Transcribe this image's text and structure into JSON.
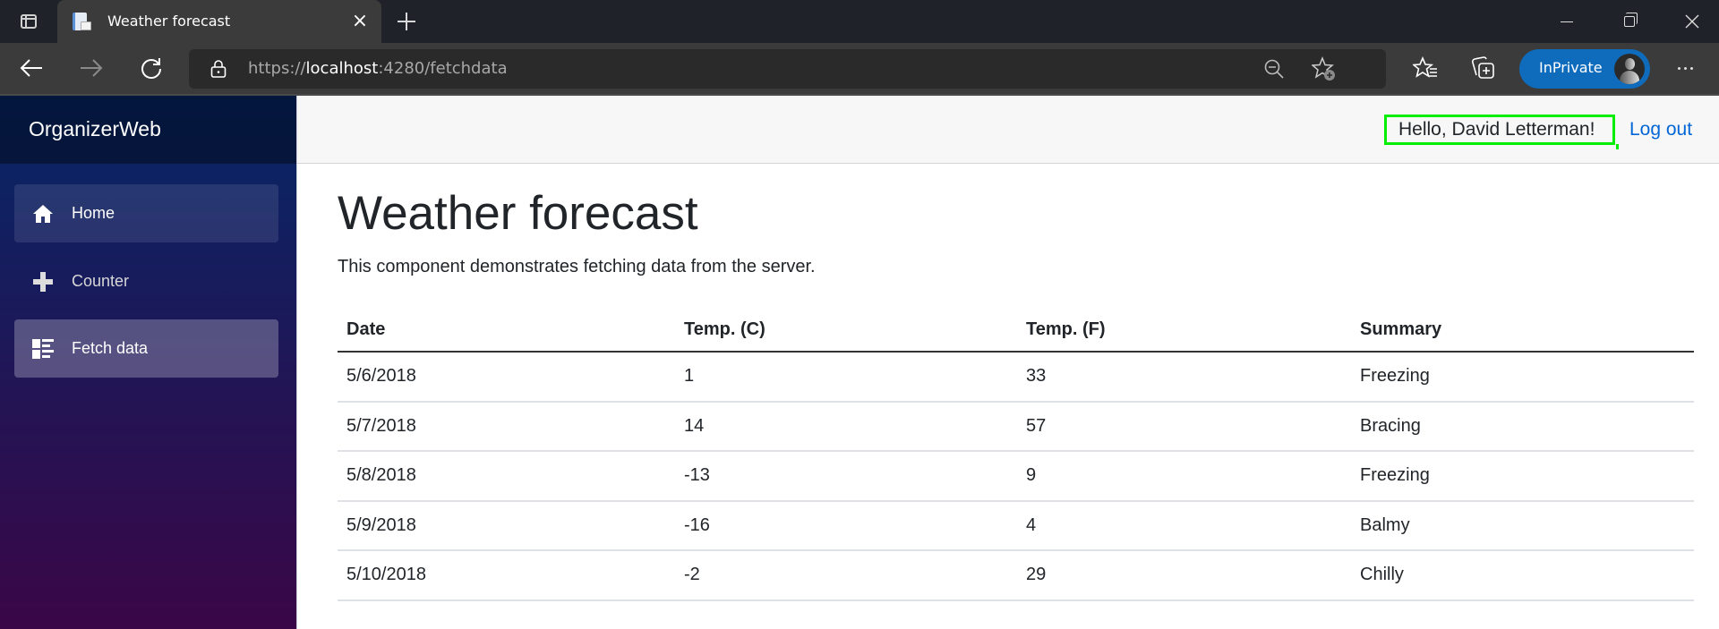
{
  "browser": {
    "tab": {
      "title": "Weather forecast",
      "favicon": "document-favicon-icon"
    },
    "url": {
      "scheme": "https://",
      "host": "localhost",
      "rest": ":4280/fetchdata"
    },
    "inprivate_label": "InPrivate",
    "icons": {
      "tab_actions": "tab-actions-icon",
      "close_tab": "close-icon",
      "new_tab": "plus-icon",
      "back": "arrow-left-icon",
      "forward": "arrow-right-icon",
      "refresh": "refresh-icon",
      "lock": "lock-icon",
      "zoom_out": "zoom-out-icon",
      "add_favorite": "star-add-icon",
      "favorites": "favorites-icon",
      "collections": "collections-icon",
      "more": "more-icon"
    },
    "tab_close_glyph": "×",
    "colors": {
      "tabstrip": "#1f2329",
      "toolbar": "#3b3b3b",
      "inprivate": "#0f6cbd"
    }
  },
  "app": {
    "brand": "OrganizerWeb",
    "nav": [
      {
        "label": "Home",
        "icon": "home-icon",
        "state": "hover"
      },
      {
        "label": "Counter",
        "icon": "plus-icon",
        "state": "normal"
      },
      {
        "label": "Fetch data",
        "icon": "list-icon",
        "state": "active"
      }
    ],
    "topbar": {
      "greeting": "Hello, David Letterman!",
      "logout": "Log out",
      "highlight_color": "#00ee00"
    },
    "colors": {
      "link": "#0366d6",
      "sidebar_top": "#052767",
      "sidebar_bottom": "#3a0647"
    }
  },
  "page": {
    "title": "Weather forecast",
    "lead": "This component demonstrates fetching data from the server.",
    "table": {
      "headers": [
        "Date",
        "Temp. (C)",
        "Temp. (F)",
        "Summary"
      ],
      "rows": [
        [
          "5/6/2018",
          "1",
          "33",
          "Freezing"
        ],
        [
          "5/7/2018",
          "14",
          "57",
          "Bracing"
        ],
        [
          "5/8/2018",
          "-13",
          "9",
          "Freezing"
        ],
        [
          "5/9/2018",
          "-16",
          "4",
          "Balmy"
        ],
        [
          "5/10/2018",
          "-2",
          "29",
          "Chilly"
        ]
      ]
    }
  }
}
